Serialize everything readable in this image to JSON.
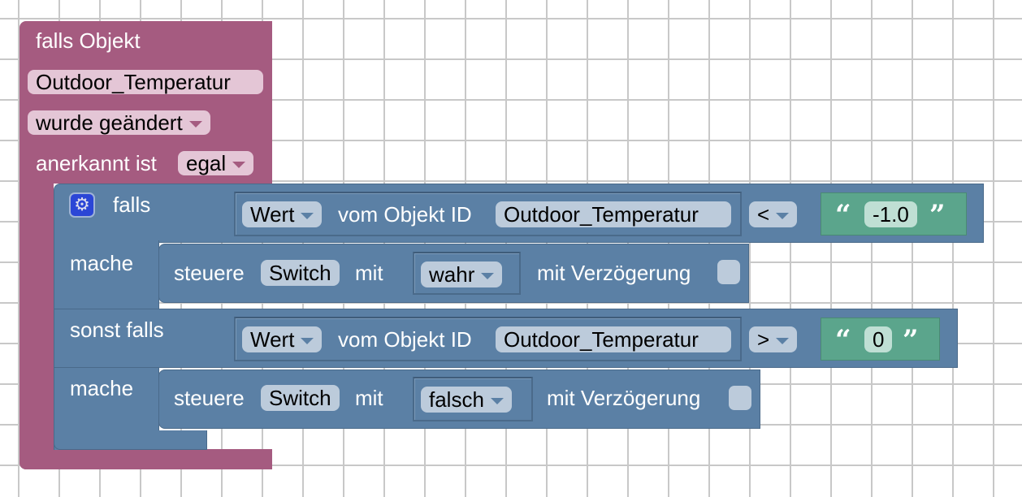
{
  "colors": {
    "event_block": "#a55b80",
    "logic_block": "#5b80a5",
    "text_block": "#5ba58c"
  },
  "trigger": {
    "title": "falls Objekt",
    "object": "Outdoor_Temperatur",
    "condition": "wurde geändert",
    "ack_label": "anerkannt ist",
    "ack_value": "egal"
  },
  "if_block": {
    "icon": "gear-icon",
    "if_label": "falls",
    "do_label": "mache",
    "elseif_label": "sonst falls",
    "do2_label": "mache"
  },
  "cond1": {
    "property": "Wert",
    "of_label": "vom Objekt ID",
    "object": "Outdoor_Temperatur",
    "operator": "<",
    "value": "-1.0"
  },
  "action1": {
    "label": "steuere",
    "target": "Switch",
    "with": "mit",
    "value": "wahr",
    "delay_label": "mit Verzögerung",
    "delay_checked": false
  },
  "cond2": {
    "property": "Wert",
    "of_label": "vom Objekt ID",
    "object": "Outdoor_Temperatur",
    "operator": ">",
    "value": "0"
  },
  "action2": {
    "label": "steuere",
    "target": "Switch",
    "with": "mit",
    "value": "falsch",
    "delay_label": "mit Verzögerung",
    "delay_checked": false
  },
  "quote_open": "“",
  "quote_close": "”"
}
